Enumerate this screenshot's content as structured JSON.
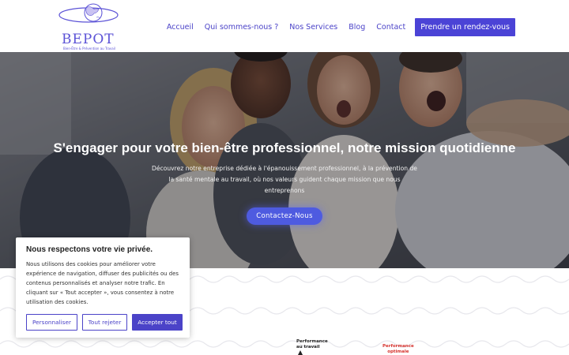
{
  "brand": {
    "name": "BEPOT",
    "tagline": "Bien-Être & Prévention au Travail",
    "accent": "#4b43d6"
  },
  "nav": {
    "items": [
      {
        "label": "Accueil"
      },
      {
        "label": "Qui sommes-nous ?"
      },
      {
        "label": "Nos Services"
      },
      {
        "label": "Blog"
      },
      {
        "label": "Contact"
      }
    ],
    "cta_label": "Prendre un rendez-vous"
  },
  "hero": {
    "title": "S'engager pour votre bien-être professionnel, notre mission quotidienne",
    "subtitle": "Découvrez notre entreprise dédiée à l'épanouissement professionnel, à la prévention de la santé mentale au travail, où nos valeurs guident chaque mission que nous entreprenons",
    "button_label": "Contactez-Nous"
  },
  "cookie": {
    "title": "Nous respectons votre vie privée.",
    "text": "Nous utilisons des cookies pour améliorer votre expérience de navigation, diffuser des publicités ou des contenus personnalisés et analyser notre trafic. En cliquant sur « Tout accepter », vous consentez à notre utilisation des cookies.",
    "customize_label": "Personnaliser",
    "reject_label": "Tout rejeter",
    "accept_label": "Accepter tout"
  },
  "section": {
    "perf_label_1_line1": "Performance",
    "perf_label_1_line2": "au travail",
    "perf_label_2_line1": "Performance",
    "perf_label_2_line2": "optimale"
  }
}
